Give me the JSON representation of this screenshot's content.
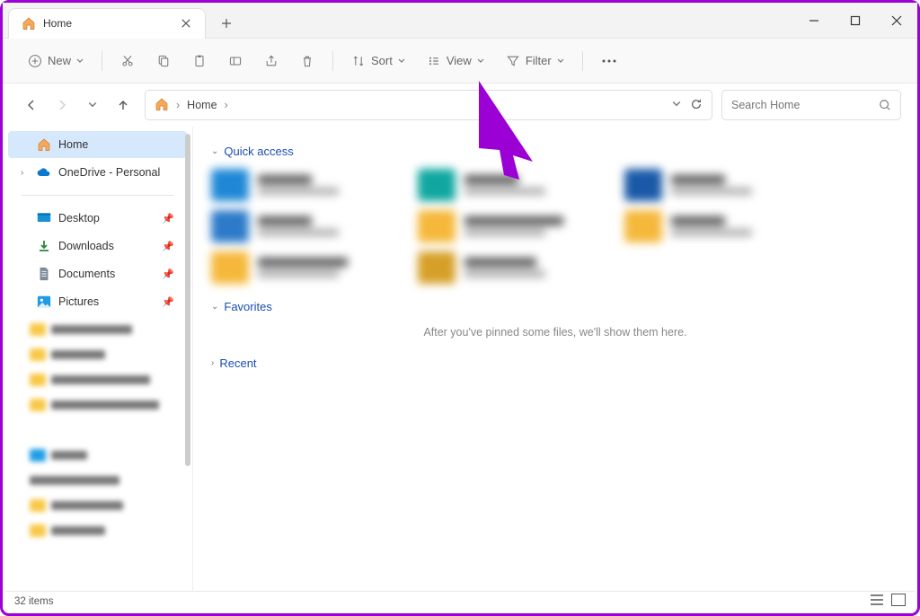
{
  "tab": {
    "title": "Home"
  },
  "toolbar": {
    "new_label": "New",
    "sort_label": "Sort",
    "view_label": "View",
    "filter_label": "Filter"
  },
  "breadcrumb": {
    "current": "Home"
  },
  "search": {
    "placeholder": "Search Home"
  },
  "sidebar": {
    "home": "Home",
    "onedrive": "OneDrive - Personal",
    "desktop": "Desktop",
    "downloads": "Downloads",
    "documents": "Documents",
    "pictures": "Pictures"
  },
  "sections": {
    "quick_access": "Quick access",
    "favorites": "Favorites",
    "favorites_empty": "After you've pinned some files, we'll show them here.",
    "recent": "Recent"
  },
  "status": {
    "item_count": "32 items"
  }
}
